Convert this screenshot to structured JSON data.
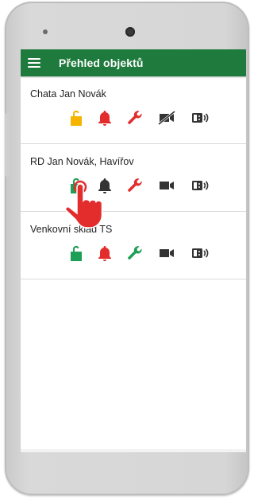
{
  "app": {
    "title": "Přehled objektů",
    "menu_icon": "hamburger-menu-icon",
    "accent_color": "#1f7a3d"
  },
  "objects": [
    {
      "name": "Chata Jan Novák",
      "icons": [
        {
          "name": "lock-open-icon",
          "color": "#f5b400"
        },
        {
          "name": "bell-icon",
          "color": "#e32d2d"
        },
        {
          "name": "wrench-icon",
          "color": "#e32d2d"
        },
        {
          "name": "camera-off-icon",
          "color": "#333333"
        },
        {
          "name": "intercom-icon",
          "color": "#333333"
        }
      ]
    },
    {
      "name": "RD Jan Novák, Havířov",
      "icons": [
        {
          "name": "lock-open-icon",
          "color": "#1e9e56"
        },
        {
          "name": "bell-icon",
          "color": "#333333"
        },
        {
          "name": "wrench-icon",
          "color": "#e32d2d"
        },
        {
          "name": "video-camera-icon",
          "color": "#333333"
        },
        {
          "name": "intercom-icon",
          "color": "#333333"
        }
      ]
    },
    {
      "name": "Venkovní sklad TS",
      "icons": [
        {
          "name": "lock-open-icon",
          "color": "#1e9e56"
        },
        {
          "name": "bell-icon",
          "color": "#e32d2d"
        },
        {
          "name": "wrench-icon",
          "color": "#1e9e56"
        },
        {
          "name": "video-camera-icon",
          "color": "#333333"
        },
        {
          "name": "intercom-icon",
          "color": "#333333"
        }
      ]
    }
  ],
  "overlay": {
    "name": "tap-hand-icon",
    "color": "#e32d2d"
  }
}
